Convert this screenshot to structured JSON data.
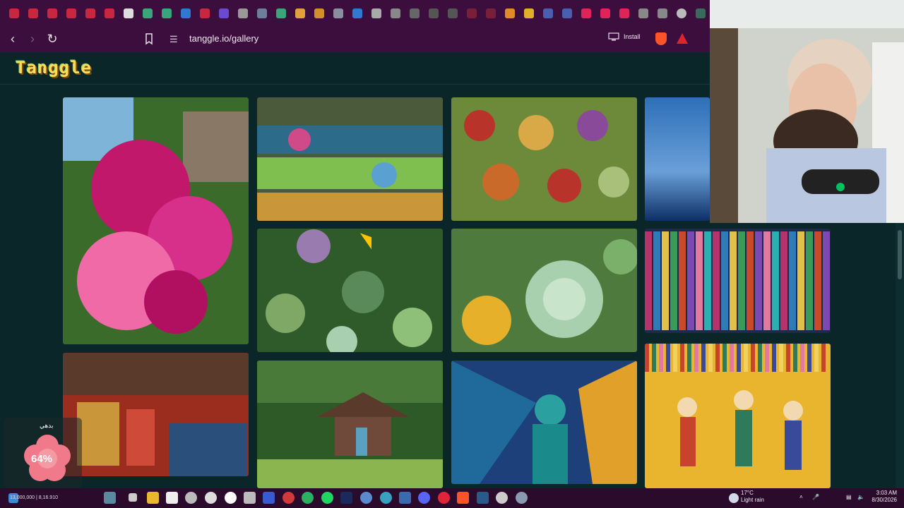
{
  "browser": {
    "url": "tanggle.io/gallery",
    "install_label": "Install"
  },
  "site": {
    "logo_text": "Tanggle"
  },
  "gallery": {
    "tiles": [
      {
        "name": "pink-lilies",
        "colors": [
          "#c2186b",
          "#f06aa7",
          "#3b6b2a"
        ]
      },
      {
        "name": "succulent-market-stall",
        "colors": [
          "#2d6b8a",
          "#7fbf4f",
          "#c9963a"
        ]
      },
      {
        "name": "colorful-succulents",
        "colors": [
          "#b8342a",
          "#6d8a3a",
          "#d9a847"
        ]
      },
      {
        "name": "blue-sky-partial",
        "colors": [
          "#1e4f8f",
          "#5a8fd0",
          "#0d2f66"
        ]
      },
      {
        "name": "succulent-garden",
        "colors": [
          "#2f5a2a",
          "#7fa867",
          "#9a7bb0"
        ]
      },
      {
        "name": "succulent-closeup",
        "colors": [
          "#4e7a3e",
          "#a8cfae",
          "#e6b02a"
        ]
      },
      {
        "name": "hanging-scarves",
        "colors": [
          "#b3336a",
          "#2f7ab8",
          "#e0c04a"
        ]
      },
      {
        "name": "textile-market",
        "colors": [
          "#9b2d1f",
          "#c9963a",
          "#2a4f7a"
        ]
      },
      {
        "name": "forest-cabin",
        "colors": [
          "#2d5a26",
          "#6f4a3a",
          "#8ab54f"
        ]
      },
      {
        "name": "carnival-costume",
        "colors": [
          "#1f6a9a",
          "#1d3f7a",
          "#e0a02a"
        ]
      },
      {
        "name": "dancing-crowd-illustration",
        "colors": [
          "#e9b52e",
          "#c8432b",
          "#2e7a5a"
        ]
      }
    ]
  },
  "widget": {
    "label": "بدهي",
    "percent": "64%",
    "sub": "…"
  },
  "taskbar": {
    "ticker": "13,000,000 | 8,16.910",
    "weather_temp": "17°C",
    "weather_desc": "Light rain",
    "time": "3:03 AM",
    "date": "8/30/2026"
  }
}
